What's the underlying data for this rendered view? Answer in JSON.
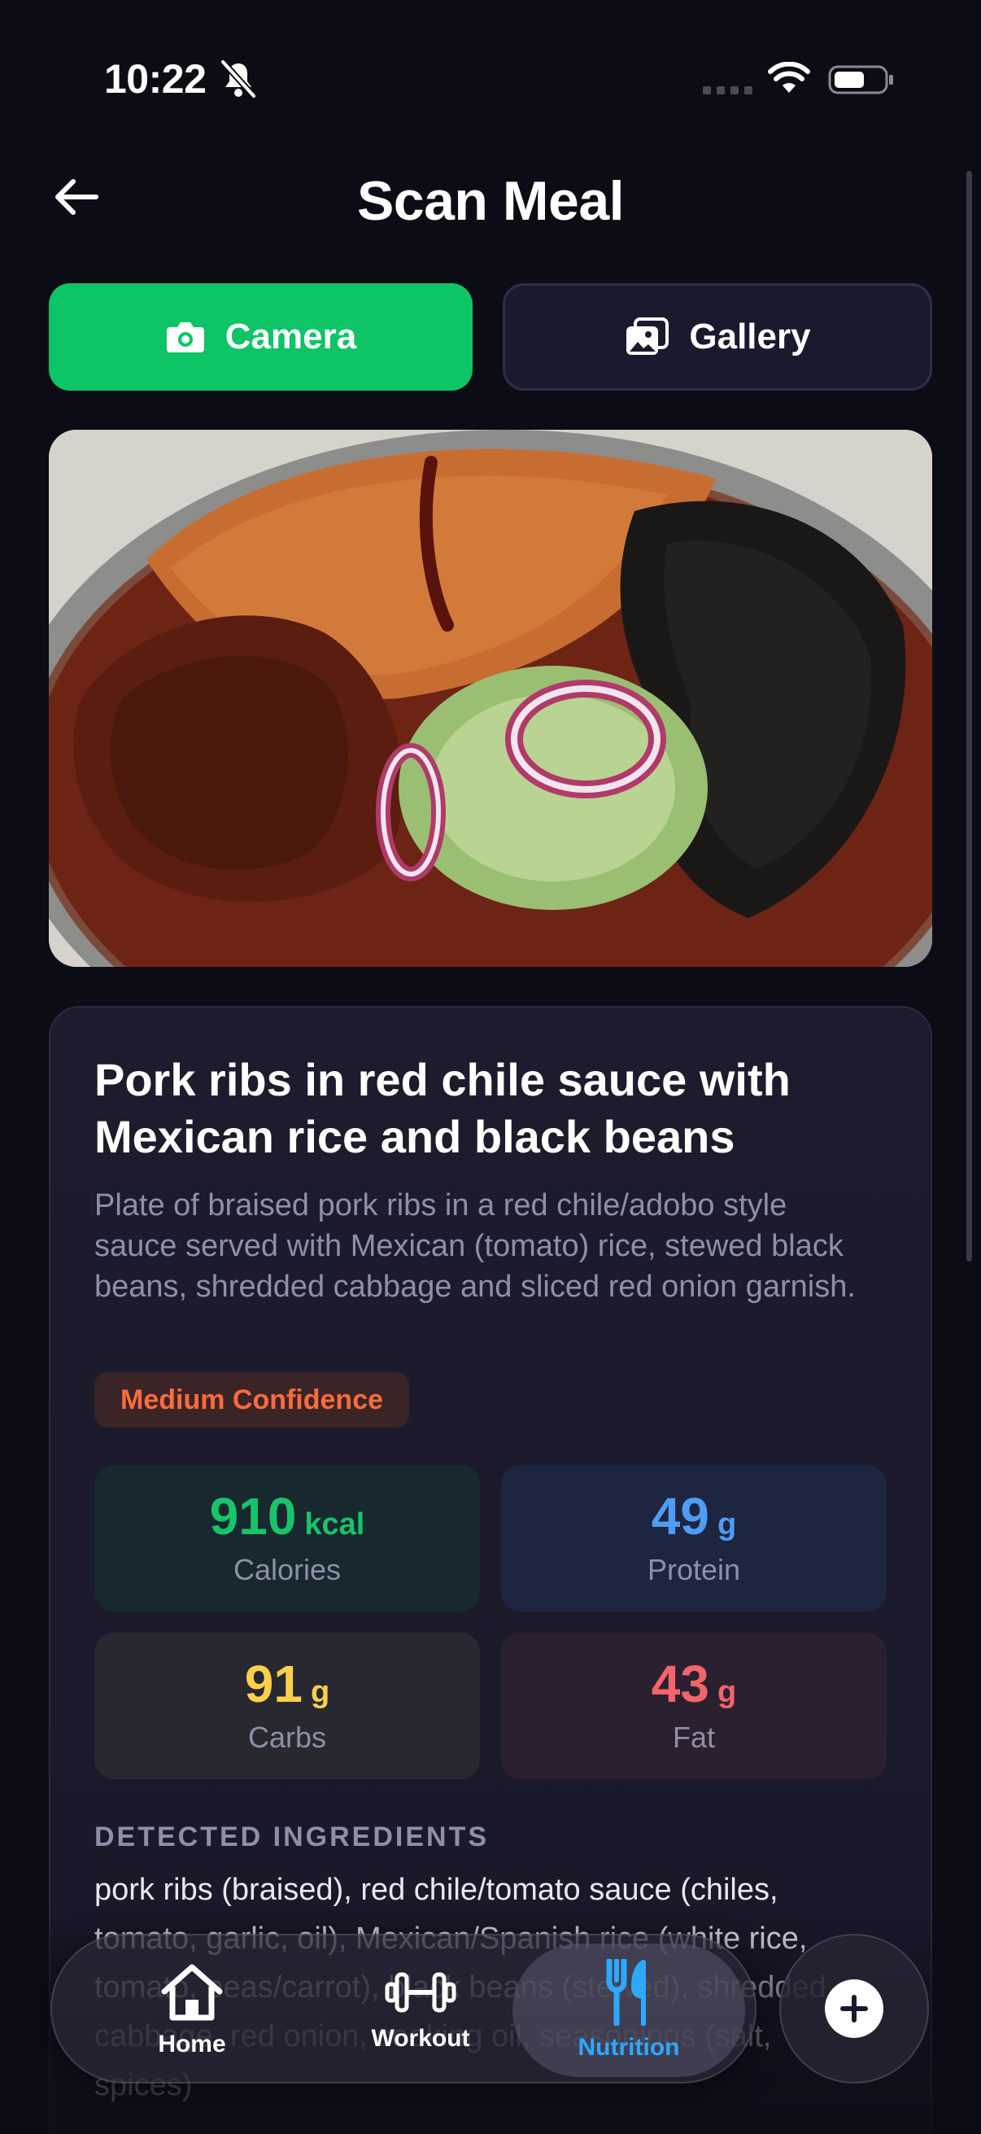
{
  "status_bar": {
    "time": "10:22"
  },
  "header": {
    "title": "Scan Meal"
  },
  "source_buttons": {
    "camera": "Camera",
    "gallery": "Gallery"
  },
  "result": {
    "name": "Pork ribs in red chile sauce with Mexican rice and black beans",
    "description": "Plate of braised pork ribs in a red chile/adobo style sauce served with Mexican (tomato) rice, stewed black beans, shredded cabbage and sliced red onion garnish.",
    "confidence": "Medium Confidence",
    "macros": {
      "calories": {
        "value": "910",
        "unit": "kcal",
        "label": "Calories"
      },
      "protein": {
        "value": "49",
        "unit": "g",
        "label": "Protein"
      },
      "carbs": {
        "value": "91",
        "unit": "g",
        "label": "Carbs"
      },
      "fat": {
        "value": "43",
        "unit": "g",
        "label": "Fat"
      }
    },
    "ingredients_heading": "DETECTED INGREDIENTS",
    "ingredients": "pork ribs (braised), red chile/tomato sauce (chiles, tomato, garlic, oil), Mexican/Spanish rice (white rice, tomato, peas/carrot), black beans (stewed), shredded cabbage, red onion, cooking oil, seasonings (salt, spices)"
  },
  "tabbar": {
    "home": "Home",
    "workout": "Workout",
    "nutrition": "Nutrition"
  },
  "colors": {
    "accent_green": "#0dc466",
    "active_tab": "#2ea8ff",
    "confidence": "#ff6b3d"
  },
  "icons": [
    "back-arrow-icon",
    "bell-slash-icon",
    "wifi-icon",
    "battery-icon",
    "camera-icon",
    "gallery-icon",
    "home-icon",
    "dumbbell-icon",
    "fork-knife-icon",
    "plus-icon"
  ]
}
